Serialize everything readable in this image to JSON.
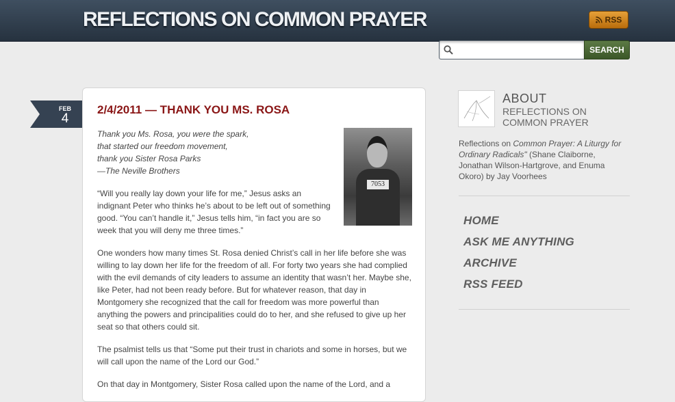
{
  "header": {
    "site_title": "REFLECTIONS ON COMMON PRAYER",
    "rss_label": "RSS",
    "rss_icon": "rss-icon"
  },
  "search": {
    "placeholder": "",
    "value": "",
    "button_label": "SEARCH",
    "icon": "search-icon"
  },
  "post": {
    "date_month": "FEB",
    "date_day": "4",
    "title": "2/4/2011 — THANK YOU MS. ROSA",
    "image_plate": "7053",
    "quote_lines": [
      "Thank you Ms. Rosa, you were the spark,",
      "that started our freedom movement,",
      "thank you Sister Rosa Parks",
      "—The Neville Brothers"
    ],
    "paragraphs": [
      "“Will you really lay down your life for me,” Jesus asks an indignant Peter who thinks he’s about to be left out of something good. “You can’t handle it,” Jesus tells him, “in fact you are so week that you will deny me three times.”",
      "One wonders how many times St. Rosa denied Christ’s call in her life before she was willing to lay down her life for the freedom of all. For forty two years she had complied with the evil demands of city leaders to assume an identity that wasn’t her. Maybe she, like Peter, had not been ready before. But for whatever reason, that day in Montgomery she recognized that the call for freedom was more powerful than anything the powers and principalities could do to her, and she refused to give up her seat so that others could sit.",
      "The psalmist tells us that “Some put their trust in chariots and some in horses, but we will call upon the name of the Lord our God.”",
      "On that day in Montgomery, Sister Rosa called upon the name of the Lord, and a"
    ]
  },
  "sidebar": {
    "about_title": "ABOUT",
    "about_subtitle": "REFLECTIONS ON COMMON PRAYER",
    "about_desc_prefix": "Reflections on ",
    "about_desc_italic": "Common Prayer: A Liturgy for Ordinary Radicals\"",
    "about_desc_suffix": " (Shane Claiborne, Jonathan Wilson-Hartgrove, and Enuma Okoro) by Jay Voorhees",
    "nav": [
      "HOME",
      "ASK ME ANYTHING",
      "ARCHIVE",
      "RSS FEED"
    ]
  },
  "colors": {
    "header_bg": "#2e3b4a",
    "title_red": "#8a1616",
    "rss_orange": "#d1871f",
    "search_green": "#4a6935",
    "date_ribbon": "#354252"
  }
}
